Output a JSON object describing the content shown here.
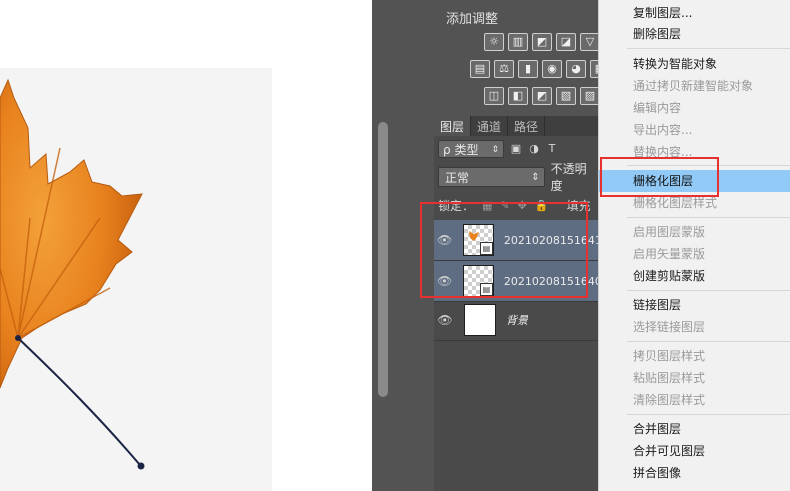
{
  "canvas_area": {},
  "adjustments_panel": {
    "title": "添加调整",
    "rows": [
      [
        "☼",
        "▥",
        "◩",
        "◪",
        "▽"
      ],
      [
        "▤",
        "⚖",
        "▮",
        "◉",
        "◕",
        "▦"
      ],
      [
        "◫",
        "◧",
        "◩",
        "▧",
        "▨"
      ]
    ]
  },
  "layers_panel": {
    "tabs": [
      "图层",
      "通道",
      "路径"
    ],
    "kind_filter": "类型",
    "kind_filter_prefix": "ρ",
    "filter_icons": [
      "▣",
      "◑",
      "T"
    ],
    "blend_mode": "正常",
    "opacity_label": "不透明度",
    "lock_label": "锁定：",
    "lock_icons": [
      "▦",
      "✎",
      "✥",
      "🔒"
    ],
    "fill_label": "填充",
    "layers": [
      {
        "name": "20210208151641",
        "visible_icon": "👁",
        "selected": true,
        "smart_object": true
      },
      {
        "name": "20210208151640",
        "visible_icon": "👁",
        "selected": true,
        "smart_object": true
      },
      {
        "name": "背景",
        "visible_icon": "👁",
        "selected": false,
        "smart_object": false
      }
    ]
  },
  "context_menu": {
    "items": [
      {
        "label": "复制图层...",
        "enabled": true
      },
      {
        "label": "删除图层",
        "enabled": true
      },
      {
        "label": "转换为智能对象",
        "enabled": true
      },
      {
        "label": "通过拷贝新建智能对象",
        "enabled": false
      },
      {
        "label": "编辑内容",
        "enabled": false
      },
      {
        "label": "导出内容...",
        "enabled": false
      },
      {
        "label": "替换内容...",
        "enabled": false
      },
      {
        "label": "栅格化图层",
        "enabled": true,
        "hovered": true
      },
      {
        "label": "栅格化图层样式",
        "enabled": false
      },
      {
        "label": "启用图层蒙版",
        "enabled": false
      },
      {
        "label": "启用矢量蒙版",
        "enabled": false
      },
      {
        "label": "创建剪贴蒙版",
        "enabled": true
      },
      {
        "label": "链接图层",
        "enabled": true
      },
      {
        "label": "选择链接图层",
        "enabled": false
      },
      {
        "label": "拷贝图层样式",
        "enabled": false
      },
      {
        "label": "粘贴图层样式",
        "enabled": false
      },
      {
        "label": "清除图层样式",
        "enabled": false
      },
      {
        "label": "合并图层",
        "enabled": true
      },
      {
        "label": "合并可见图层",
        "enabled": true
      },
      {
        "label": "拼合图像",
        "enabled": true
      }
    ]
  },
  "colors": {
    "panel_bg": "#535353",
    "selected_layer": "#5f6d82",
    "menu_hover": "#91c9f7",
    "highlight_box": "#e8312f",
    "leaf_orange": "#e8821e"
  },
  "icons": {
    "eye": "eye-icon",
    "lock": "lock-icon",
    "leaf": "maple-leaf-image"
  }
}
